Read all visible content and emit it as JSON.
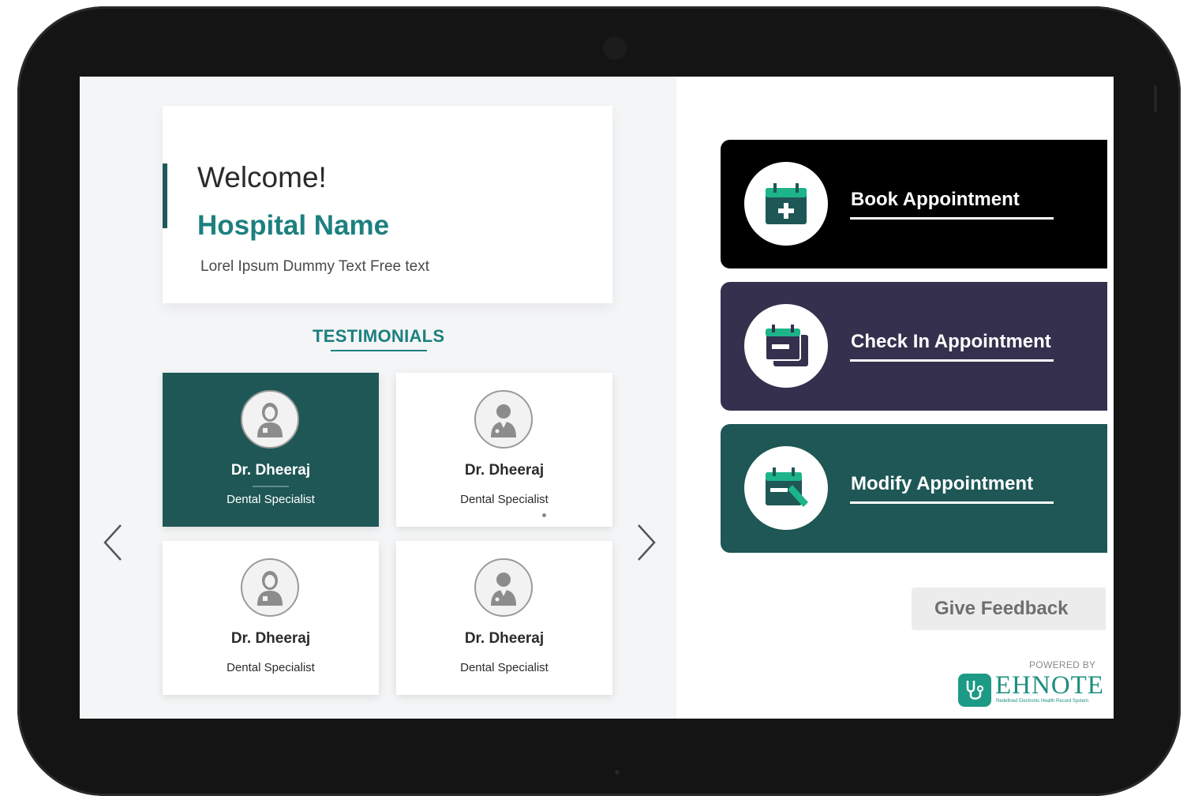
{
  "welcome": {
    "greeting": "Welcome!",
    "hospital_name": "Hospital Name",
    "subtitle": "Lorel Ipsum Dummy Text Free text"
  },
  "testimonials": {
    "title": "TESTIMONIALS",
    "cards": [
      {
        "name": "Dr. Dheeraj",
        "role": "Dental Specialist",
        "avatar": "female-doctor-icon",
        "active": true
      },
      {
        "name": "Dr. Dheeraj",
        "role": "Dental Specialist",
        "avatar": "male-doctor-icon",
        "active": false
      },
      {
        "name": "Dr. Dheeraj",
        "role": "Dental Specialist",
        "avatar": "female-doctor-icon",
        "active": false
      },
      {
        "name": "Dr. Dheeraj",
        "role": "Dental Specialist",
        "avatar": "male-doctor-icon",
        "active": false
      }
    ],
    "prev_icon": "chevron-left-icon",
    "next_icon": "chevron-right-icon"
  },
  "actions": [
    {
      "label": "Book Appointment",
      "icon": "calendar-plus-icon",
      "color": "#000000"
    },
    {
      "label": "Check In Appointment",
      "icon": "calendar-checkin-icon",
      "color": "#34304d"
    },
    {
      "label": "Modify Appointment",
      "icon": "calendar-edit-icon",
      "color": "#1e5755"
    }
  ],
  "feedback": {
    "label": "Give Feedback"
  },
  "footer": {
    "powered_by": "POWERED BY",
    "brand": "EHNOTE",
    "tagline": "Redefined Electronic Health Record System"
  },
  "colors": {
    "accent_teal": "#1d7f80",
    "card_active": "#1e5755",
    "icon_green": "#1db48a"
  }
}
